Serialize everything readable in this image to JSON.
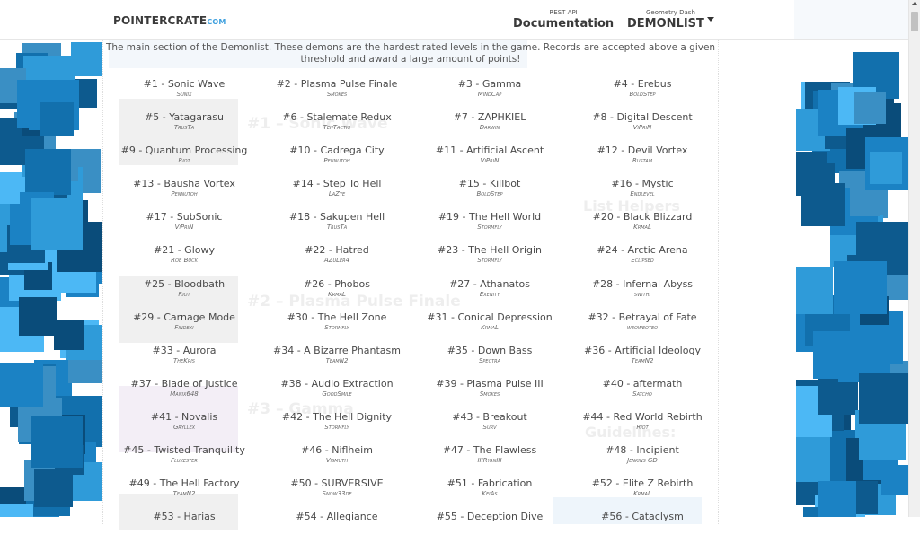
{
  "header": {
    "logo_main": "POINTERCRATE",
    "logo_domain": "COM",
    "nav": [
      {
        "small": "REST API",
        "big": "Documentation"
      },
      {
        "small": "Geometry Dash",
        "big": "DEMONLIST",
        "dropdown": true
      }
    ]
  },
  "intro": "The main section of the Demonlist. These demons are the hardest rated levels in the game. Records are accepted above a given threshold and award a large amount of points!",
  "colors": {
    "accent": "#3fa0de",
    "bg_squares": [
      "#0d5a8e",
      "#1b82c4",
      "#2f9bd9",
      "#4cb8f5",
      "#1270ad",
      "#3a8fc4",
      "#0a4c7a"
    ]
  },
  "demons": [
    {
      "rank": "#1",
      "name": "Sonic Wave",
      "publisher": "Sunix"
    },
    {
      "rank": "#2",
      "name": "Plasma Pulse Finale",
      "publisher": "Smokes"
    },
    {
      "rank": "#3",
      "name": "Gamma",
      "publisher": "MindCap"
    },
    {
      "rank": "#4",
      "name": "Erebus",
      "publisher": "BoldStep"
    },
    {
      "rank": "#5",
      "name": "Yatagarasu",
      "publisher": "TrusTa"
    },
    {
      "rank": "#6",
      "name": "Stalemate Redux",
      "publisher": "TehTactiq"
    },
    {
      "rank": "#7",
      "name": "ZAPHKIEL",
      "publisher": "Darwin"
    },
    {
      "rank": "#8",
      "name": "Digital Descent",
      "publisher": "ViPriN"
    },
    {
      "rank": "#9",
      "name": "Quantum Processing",
      "publisher": "Riot"
    },
    {
      "rank": "#10",
      "name": "Cadrega City",
      "publisher": "Pennutoh"
    },
    {
      "rank": "#11",
      "name": "Artificial Ascent",
      "publisher": "ViPriN"
    },
    {
      "rank": "#12",
      "name": "Devil Vortex",
      "publisher": "Rustam"
    },
    {
      "rank": "#13",
      "name": "Bausha Vortex",
      "publisher": "Pennutoh"
    },
    {
      "rank": "#14",
      "name": "Step To Hell",
      "publisher": "LaZye"
    },
    {
      "rank": "#15",
      "name": "Killbot",
      "publisher": "BoldStep"
    },
    {
      "rank": "#16",
      "name": "Mystic",
      "publisher": "Endlevel"
    },
    {
      "rank": "#17",
      "name": "SubSonic",
      "publisher": "ViPriN"
    },
    {
      "rank": "#18",
      "name": "Sakupen Hell",
      "publisher": "TrusTa"
    },
    {
      "rank": "#19",
      "name": "The Hell World",
      "publisher": "Stormfly"
    },
    {
      "rank": "#20",
      "name": "Black Blizzard",
      "publisher": "KrmaL"
    },
    {
      "rank": "#21",
      "name": "Glowy",
      "publisher": "Rob Buck"
    },
    {
      "rank": "#22",
      "name": "Hatred",
      "publisher": "AZuLer4"
    },
    {
      "rank": "#23",
      "name": "The Hell Origin",
      "publisher": "Stormfly"
    },
    {
      "rank": "#24",
      "name": "Arctic Arena",
      "publisher": "Eclipsed"
    },
    {
      "rank": "#25",
      "name": "Bloodbath",
      "publisher": "Riot"
    },
    {
      "rank": "#26",
      "name": "Phobos",
      "publisher": "KrmaL"
    },
    {
      "rank": "#27",
      "name": "Athanatos",
      "publisher": "Exenity"
    },
    {
      "rank": "#28",
      "name": "Infernal Abyss",
      "publisher": "swithi"
    },
    {
      "rank": "#29",
      "name": "Carnage Mode",
      "publisher": "Findexi"
    },
    {
      "rank": "#30",
      "name": "The Hell Zone",
      "publisher": "Stormfly"
    },
    {
      "rank": "#31",
      "name": "Conical Depression",
      "publisher": "KrmaL"
    },
    {
      "rank": "#32",
      "name": "Betrayal of Fate",
      "publisher": "weoweoteo"
    },
    {
      "rank": "#33",
      "name": "Aurora",
      "publisher": "TheKris"
    },
    {
      "rank": "#34",
      "name": "A Bizarre Phantasm",
      "publisher": "TeamN2"
    },
    {
      "rank": "#35",
      "name": "Down Bass",
      "publisher": "Spectra"
    },
    {
      "rank": "#36",
      "name": "Artificial Ideology",
      "publisher": "TeamN2"
    },
    {
      "rank": "#37",
      "name": "Blade of Justice",
      "publisher": "Manix648"
    },
    {
      "rank": "#38",
      "name": "Audio Extraction",
      "publisher": "GoodSmile"
    },
    {
      "rank": "#39",
      "name": "Plasma Pulse III",
      "publisher": "Smokes"
    },
    {
      "rank": "#40",
      "name": "aftermath",
      "publisher": "Satcho"
    },
    {
      "rank": "#41",
      "name": "Novalis",
      "publisher": "Gryllex"
    },
    {
      "rank": "#42",
      "name": "The Hell Dignity",
      "publisher": "Stormfly"
    },
    {
      "rank": "#43",
      "name": "Breakout",
      "publisher": "Surv"
    },
    {
      "rank": "#44",
      "name": "Red World Rebirth",
      "publisher": "Riot"
    },
    {
      "rank": "#45",
      "name": "Twisted Tranquility",
      "publisher": "Flukester"
    },
    {
      "rank": "#46",
      "name": "Niflheim",
      "publisher": "Vismuth"
    },
    {
      "rank": "#47",
      "name": "The Flawless",
      "publisher": "IIIRyanIII"
    },
    {
      "rank": "#48",
      "name": "Incipient",
      "publisher": "Jenkins GD"
    },
    {
      "rank": "#49",
      "name": "The Hell Factory",
      "publisher": "TeamN2"
    },
    {
      "rank": "#50",
      "name": "SUBVERSIVE",
      "publisher": "Snow33de"
    },
    {
      "rank": "#51",
      "name": "Fabrication",
      "publisher": "KeiAs"
    },
    {
      "rank": "#52",
      "name": "Elite Z Rebirth",
      "publisher": "KrmaL"
    },
    {
      "rank": "#53",
      "name": "Harias",
      "publisher": ""
    },
    {
      "rank": "#54",
      "name": "Allegiance",
      "publisher": ""
    },
    {
      "rank": "#55",
      "name": "Deception Dive",
      "publisher": ""
    },
    {
      "rank": "#56",
      "name": "Cataclysm",
      "publisher": ""
    }
  ],
  "ghost_text": {
    "entry1_title": "#1 – Sonic Wave",
    "entry2_title": "#2 – Plasma Pulse Finale",
    "entry3_title": "#3 – Gamma",
    "sidebar_heading1": "List Helpers",
    "sidebar_heading2": "Guidelines:"
  }
}
